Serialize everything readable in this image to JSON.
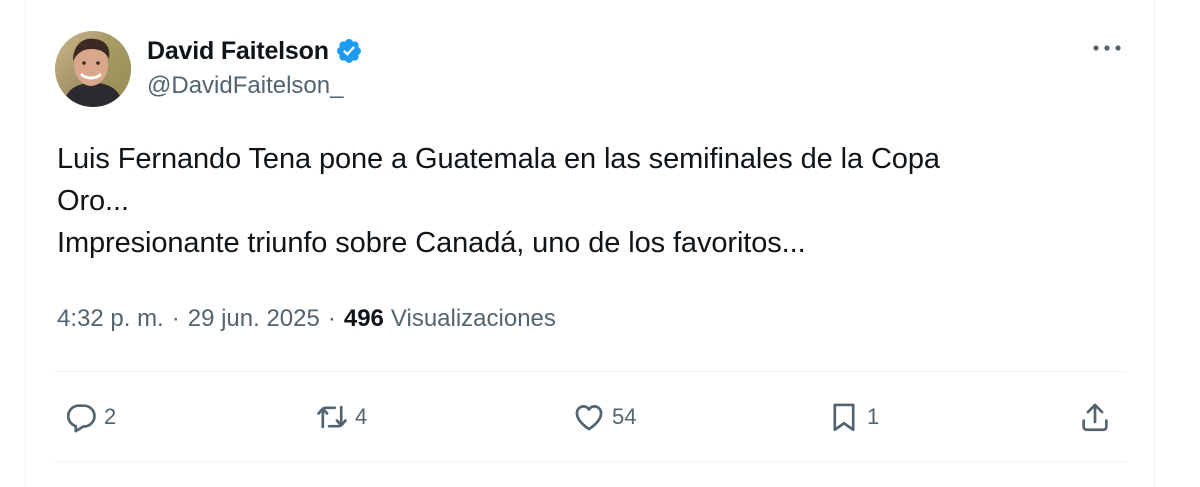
{
  "author": {
    "name": "David Faitelson",
    "handle": "@DavidFaitelson_",
    "verified_color": "#1d9bf0"
  },
  "post": {
    "lines": [
      "Luis Fernando Tena pone a Guatemala en las semifinales de la Copa",
      "Oro...",
      "Impresionante triunfo sobre Canadá, uno de los favoritos..."
    ]
  },
  "meta": {
    "time": "4:32 p. m.",
    "separator": "·",
    "date": "29 jun. 2025",
    "views_count": "496",
    "views_label": "Visualizaciones"
  },
  "actions": {
    "replies": "2",
    "reposts": "4",
    "likes": "54",
    "bookmarks": "1"
  },
  "icons": {
    "more": "more-horizontal-icon",
    "reply": "reply-icon",
    "repost": "repost-icon",
    "like": "heart-icon",
    "bookmark": "bookmark-icon",
    "share": "share-icon",
    "verified": "verified-badge-icon"
  },
  "colors": {
    "text_primary": "#0f1419",
    "text_secondary": "#536471",
    "divider": "#eff3f4"
  }
}
